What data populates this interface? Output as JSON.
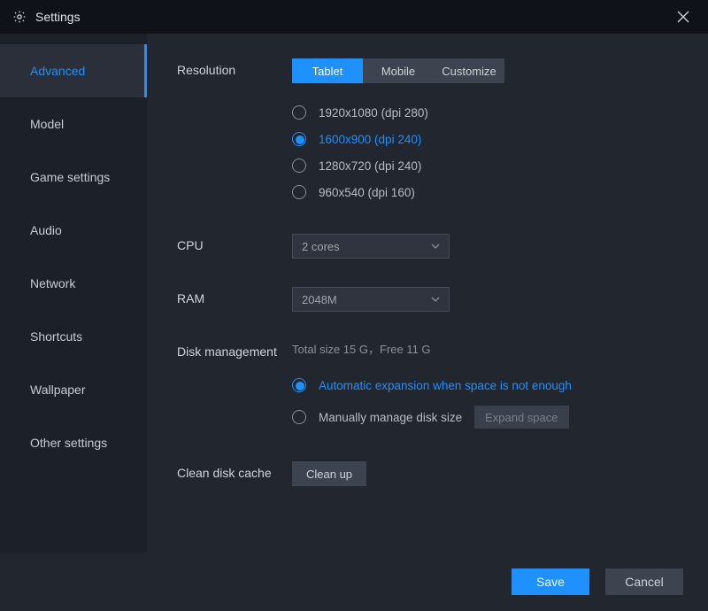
{
  "window": {
    "title": "Settings"
  },
  "sidebar": {
    "items": [
      {
        "label": "Advanced",
        "active": true
      },
      {
        "label": "Model"
      },
      {
        "label": "Game settings"
      },
      {
        "label": "Audio"
      },
      {
        "label": "Network"
      },
      {
        "label": "Shortcuts"
      },
      {
        "label": "Wallpaper"
      },
      {
        "label": "Other settings"
      }
    ]
  },
  "resolution": {
    "label": "Resolution",
    "tabs": [
      {
        "label": "Tablet",
        "active": true
      },
      {
        "label": "Mobile"
      },
      {
        "label": "Customize"
      }
    ],
    "options": [
      {
        "label": "1920x1080  (dpi 280)",
        "selected": false
      },
      {
        "label": "1600x900  (dpi 240)",
        "selected": true
      },
      {
        "label": "1280x720  (dpi 240)",
        "selected": false
      },
      {
        "label": "960x540  (dpi 160)",
        "selected": false
      }
    ]
  },
  "cpu": {
    "label": "CPU",
    "value": "2 cores"
  },
  "ram": {
    "label": "RAM",
    "value": "2048M"
  },
  "disk": {
    "label": "Disk management",
    "info": "Total size 15 G，Free 11 G",
    "options": [
      {
        "label": "Automatic expansion when space is not enough",
        "selected": true
      },
      {
        "label": "Manually manage disk size",
        "selected": false
      }
    ],
    "expand_label": "Expand space"
  },
  "clean": {
    "label": "Clean disk cache",
    "button": "Clean up"
  },
  "footer": {
    "save": "Save",
    "cancel": "Cancel"
  }
}
